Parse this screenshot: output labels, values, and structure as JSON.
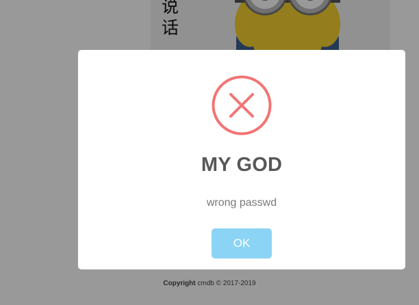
{
  "background": {
    "vertical_text": "说话",
    "footer": {
      "label": "Copyright",
      "rest": " cmdb © 2017-2019"
    }
  },
  "modal": {
    "icon": "error-x-icon",
    "title": "MY GOD",
    "message": "wrong passwd",
    "ok_label": "OK"
  },
  "colors": {
    "error": "#f27474",
    "confirm_button": "#8cd4f5",
    "overlay": "rgba(0,0,0,0.4)"
  }
}
